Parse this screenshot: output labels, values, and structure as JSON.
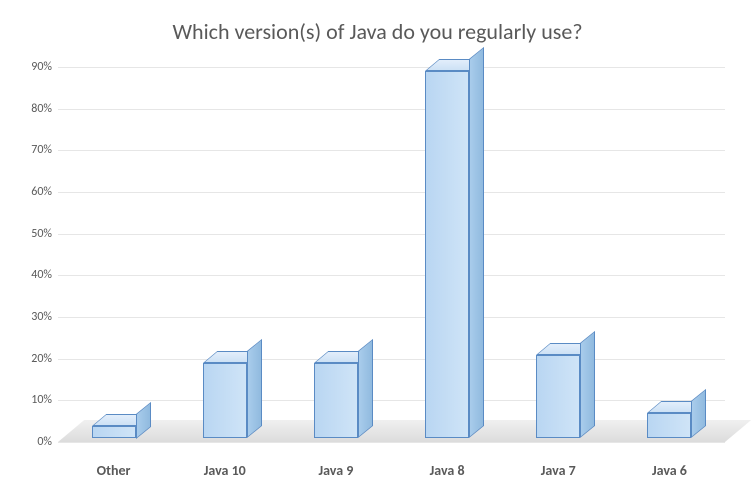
{
  "chart_data": {
    "type": "bar",
    "title": "Which version(s) of Java do you regularly use?",
    "categories": [
      "Other",
      "Java 10",
      "Java 9",
      "Java 8",
      "Java 7",
      "Java 6"
    ],
    "values": [
      3,
      18,
      18,
      88,
      20,
      6
    ],
    "xlabel": "",
    "ylabel": "",
    "ylim": [
      0,
      90
    ],
    "yticks": [
      0,
      10,
      20,
      30,
      40,
      50,
      60,
      70,
      80,
      90
    ],
    "ytick_labels": [
      "0%",
      "10%",
      "20%",
      "30%",
      "40%",
      "50%",
      "60%",
      "70%",
      "80%",
      "90%"
    ]
  }
}
